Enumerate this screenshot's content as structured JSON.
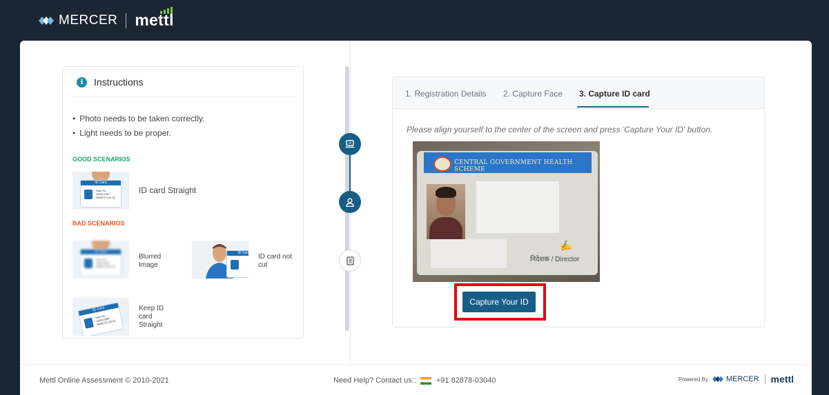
{
  "header": {
    "mercer_text": "MERCER",
    "mettl_text": "mettl"
  },
  "instructions": {
    "title": "Instructions",
    "bullets": [
      "Photo needs to be taken correctly.",
      "Light needs to be proper."
    ],
    "good_heading": "GOOD SCENARIOS",
    "bad_heading": "BAD SCENARIOS",
    "good": [
      {
        "label": "ID card Straight"
      }
    ],
    "bad": [
      {
        "label_line1": "Blurred",
        "label_line2": "Image"
      },
      {
        "label_line1": "ID card not",
        "label_line2": "cut"
      },
      {
        "label_line1": "Keep ID",
        "label_line2": "card",
        "label_line3": "Straight"
      }
    ],
    "thumb_card": {
      "band": "ID Card",
      "name": "Sam Ro",
      "date": "15/02/1997",
      "number": "3898737120-01"
    }
  },
  "tabs": [
    {
      "label": "1. Registration Details",
      "active": false
    },
    {
      "label": "2. Capture Face",
      "active": false
    },
    {
      "label": "3. Capture ID card",
      "active": true
    }
  ],
  "capture": {
    "hint": "Please align yourself to the center of the screen and press 'Capture Your ID' button.",
    "card_banner": "CENTRAL GOVERNMENT HEALTH SCHEME",
    "card_director": "निदेशक / Director",
    "button_label": "Capture Your ID"
  },
  "colors": {
    "primary": "#175d86",
    "good": "#1aa46a",
    "bad": "#e2562a",
    "highlight": "#e5000f"
  },
  "footer": {
    "copyright": "Mettl Online Assessment © 2010-2021",
    "help": "Need Help? Contact us::",
    "phone": "+91 82878-03040",
    "powered_by": "Powered By",
    "mercer_text": "MERCER",
    "mettl_text": "mettl"
  }
}
